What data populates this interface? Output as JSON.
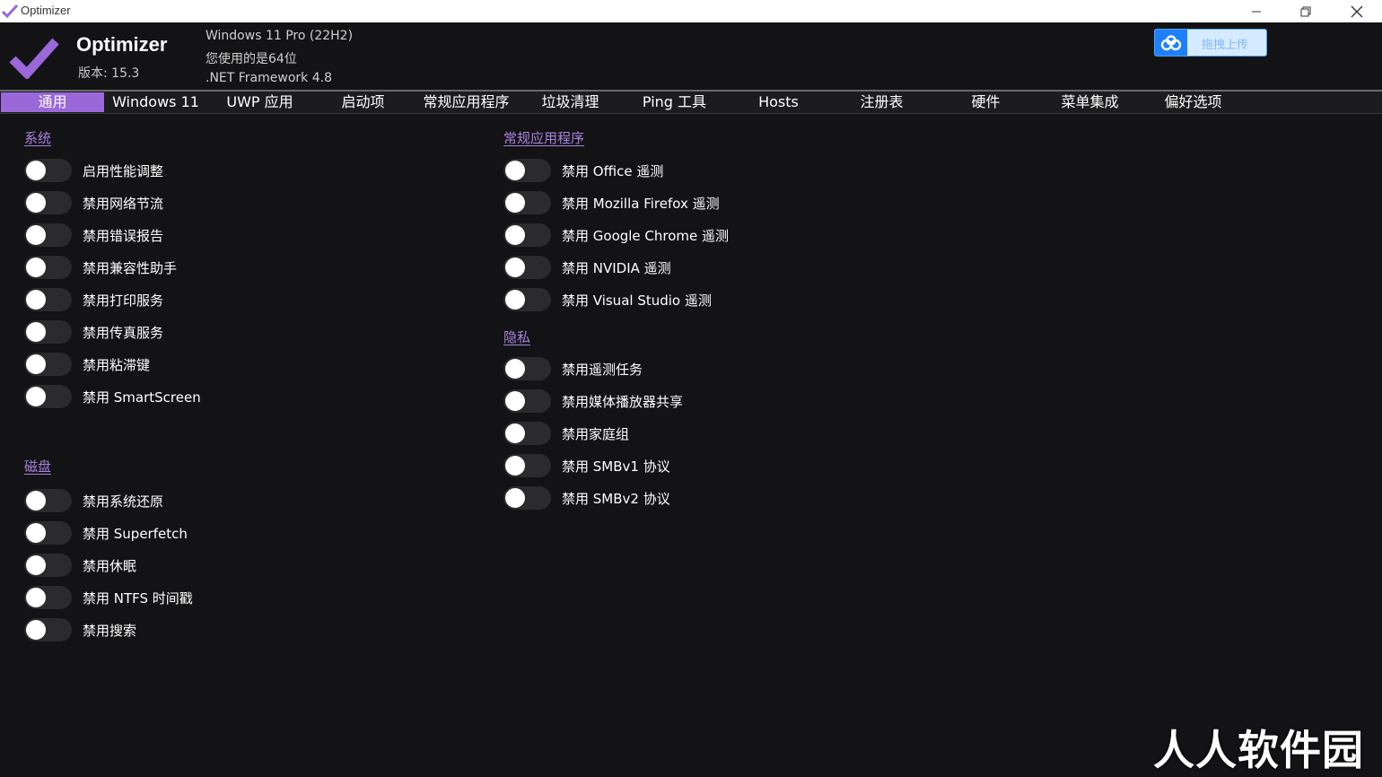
{
  "window": {
    "title": "Optimizer"
  },
  "header": {
    "app_name": "Optimizer",
    "version": "版本: 15.3",
    "os": "Windows 11 Pro (22H2)",
    "arch": "您使用的是64位",
    "framework": ".NET Framework 4.8",
    "upload_label": "拖拽上传"
  },
  "tabs": [
    {
      "label": "通用",
      "active": true
    },
    {
      "label": "Windows 11"
    },
    {
      "label": "UWP 应用"
    },
    {
      "label": "启动项"
    },
    {
      "label": "常规应用程序"
    },
    {
      "label": "垃圾清理"
    },
    {
      "label": "Ping 工具"
    },
    {
      "label": "Hosts"
    },
    {
      "label": "注册表"
    },
    {
      "label": "硬件"
    },
    {
      "label": "菜单集成"
    },
    {
      "label": "偏好选项"
    }
  ],
  "sections": {
    "system": {
      "title": "系统",
      "items": [
        "启用性能调整",
        "禁用网络节流",
        "禁用错误报告",
        "禁用兼容性助手",
        "禁用打印服务",
        "禁用传真服务",
        "禁用粘滞键",
        "禁用 SmartScreen"
      ]
    },
    "disk": {
      "title": "磁盘",
      "items": [
        "禁用系统还原",
        "禁用 Superfetch",
        "禁用休眠",
        "禁用 NTFS 时间戳",
        "禁用搜索"
      ]
    },
    "apps": {
      "title": "常规应用程序",
      "items": [
        "禁用 Office 遥测",
        "禁用 Mozilla Firefox 遥测",
        "禁用 Google Chrome 遥测",
        "禁用 NVIDIA 遥测",
        "禁用 Visual Studio 遥测"
      ]
    },
    "privacy": {
      "title": "隐私",
      "items": [
        "禁用遥测任务",
        "禁用媒体播放器共享",
        "禁用家庭组",
        "禁用 SMBv1 协议",
        "禁用 SMBv2 协议"
      ]
    }
  },
  "watermark": "人人软件园",
  "colors": {
    "accent": "#9a68d8",
    "background": "#131315",
    "toggle_off": "#2b2b2e"
  }
}
